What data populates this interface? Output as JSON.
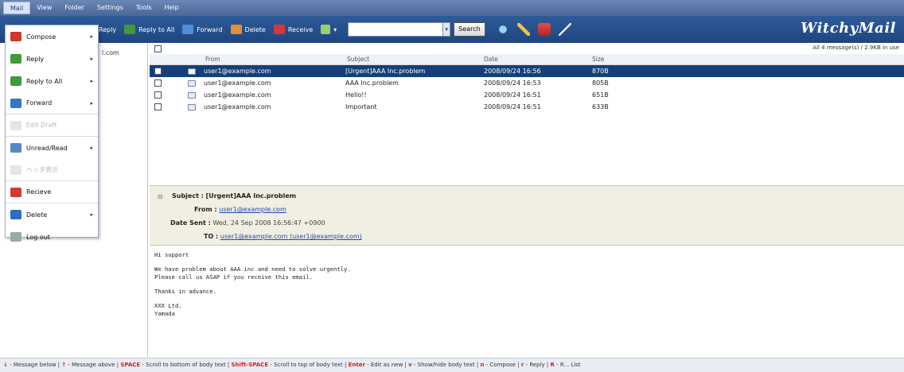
{
  "menubar": {
    "items": [
      "Mail",
      "View",
      "Folder",
      "Settings",
      "Tools",
      "Help"
    ]
  },
  "toolbar": {
    "reply_label": "Reply",
    "reply_all_label": "Reply to All",
    "forward_label": "Forward",
    "delete_label": "Delete",
    "receive_label": "Receive",
    "search_value": "",
    "search_button": "Search",
    "logo": "WitchyMail"
  },
  "dropdown": {
    "items": [
      {
        "label": "Compose",
        "icon": "compose-icon",
        "color": "#c83a2a",
        "arrow": "▸"
      },
      {
        "label": "Reply",
        "icon": "reply-icon",
        "color": "#3f9a3a",
        "arrow": "▸"
      },
      {
        "label": "Reply to All",
        "icon": "reply-all-icon",
        "color": "#3f9a3a",
        "arrow": "▸"
      },
      {
        "label": "Forward",
        "icon": "forward-icon",
        "color": "#3478c4",
        "arrow": "▸"
      },
      {
        "label": "Edit Draft",
        "icon": "edit-draft-icon",
        "color": "#e5e5e5",
        "arrow": ""
      },
      {
        "label": "Unread/Read",
        "icon": "unread-read-icon",
        "color": "#5a86c4",
        "arrow": "▸"
      },
      {
        "label": "ヘッダ表示",
        "icon": "header-icon",
        "color": "#e5e5e5",
        "arrow": ""
      },
      {
        "label": "Recieve",
        "icon": "receive-icon",
        "color": "#d23a3a",
        "arrow": ""
      },
      {
        "label": "Delete",
        "icon": "delete-icon",
        "color": "#2c6fc0",
        "arrow": "▸"
      },
      {
        "label": "Log out",
        "icon": "logout-icon",
        "color": "#9aa",
        "arrow": ""
      }
    ]
  },
  "folder_pane": {
    "account": "l.com"
  },
  "list": {
    "usage": "All 4 message(s) / 2.9KB in use",
    "columns": {
      "from": "From",
      "subject": "Subject",
      "date": "Date",
      "size": "Size"
    },
    "rows": [
      {
        "from": "user1@example.com",
        "subject": "[Urgent]AAA Inc.problem",
        "date": "2008/09/24 16:56",
        "size": "870B",
        "selected": true
      },
      {
        "from": "user1@example.com",
        "subject": "AAA Inc.problem",
        "date": "2008/09/24 16:53",
        "size": "805B",
        "selected": false
      },
      {
        "from": "user1@example.com",
        "subject": "Hello!!",
        "date": "2008/09/24 16:51",
        "size": "651B",
        "selected": false
      },
      {
        "from": "user1@example.com",
        "subject": "Important",
        "date": "2008/09/24 16:51",
        "size": "633B",
        "selected": false
      }
    ]
  },
  "header": {
    "subject_label": "Subject :",
    "subject": "[Urgent]AAA Inc.problem",
    "from_label": "From :",
    "from": "user1@example.com",
    "date_label": "Date Sent :",
    "date": "Wed, 24 Sep 2008 16:56:47 +0900",
    "to_label": "TO :",
    "to": "user1@example.com (user1@example.com)"
  },
  "body": {
    "text": "Hi support\n\nWe have problem about AAA inc and need to solve urgently.\nPlease call us ASAP if you receive this email.\n\nThanks in advance.\n\nXXX Ltd.\nYamada"
  },
  "status": {
    "segments": [
      {
        "k": "↓",
        "t": " - Message below | "
      },
      {
        "k": "↑",
        "t": " - Message above | "
      },
      {
        "k": "SPACE",
        "t": " - Scroll to bottom of body text | "
      },
      {
        "k": "Shift-SPACE",
        "t": " - Scroll to top of body text | "
      },
      {
        "k": "Enter",
        "t": " - Edit as new | "
      },
      {
        "k": "v",
        "t": " - Show/hide body text | "
      },
      {
        "k": "n",
        "t": " - Compose | "
      },
      {
        "k": "r",
        "t": " - Reply | "
      },
      {
        "k": "R",
        "t": " - R... List"
      }
    ]
  }
}
